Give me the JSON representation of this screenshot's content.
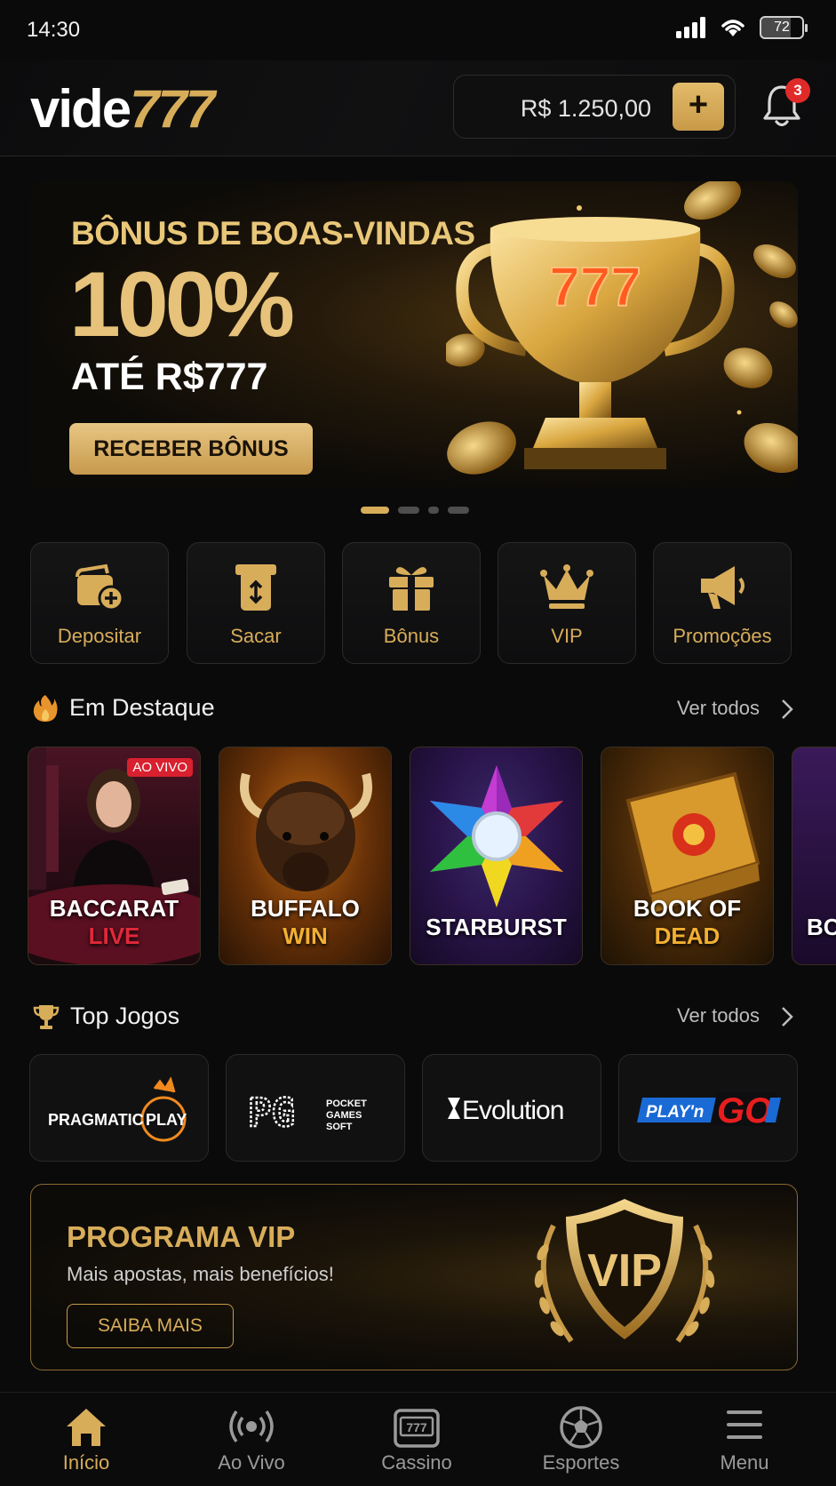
{
  "status_bar": {
    "time": "14:30",
    "battery": "72"
  },
  "header": {
    "logo_white": "vide",
    "logo_gold": "777",
    "balance": "R$ 1.250,00",
    "add_label": "+",
    "notification_count": "3"
  },
  "banner": {
    "title": "BÔNUS DE BOAS-VINDAS",
    "percent": "100%",
    "limit": "ATÉ R$777",
    "cta": "RECEBER BÔNUS",
    "trophy_text": "777",
    "slides": 4,
    "active_slide": 1
  },
  "quick_actions": [
    {
      "label": "Depositar",
      "icon": "wallet-plus-icon"
    },
    {
      "label": "Sacar",
      "icon": "withdraw-icon"
    },
    {
      "label": "Bônus",
      "icon": "gift-icon"
    },
    {
      "label": "VIP",
      "icon": "crown-icon"
    },
    {
      "label": "Promoções",
      "icon": "megaphone-icon"
    }
  ],
  "featured": {
    "title": "Em Destaque",
    "link": "Ver todos",
    "games": [
      {
        "line1": "BACCARAT",
        "line2": "LIVE",
        "badge": "AO VIVO"
      },
      {
        "line1": "BUFFALO",
        "line2": "WIN"
      },
      {
        "line1": "STARBURST",
        "line2": ""
      },
      {
        "line1": "BOOK OF",
        "line2": "DEAD"
      },
      {
        "line1": "BC",
        "line2": ""
      }
    ]
  },
  "top_games": {
    "title": "Top Jogos",
    "link": "Ver todos",
    "providers": [
      {
        "name": "PRAGMATIC",
        "name2": "PLAY"
      },
      {
        "name": "PG",
        "name2": "POCKET GAMES SOFT"
      },
      {
        "name": "Evolution"
      },
      {
        "name": "PLAY'n",
        "name2": "GO"
      }
    ]
  },
  "vip": {
    "title": "PROGRAMA VIP",
    "subtitle": "Mais apostas, mais benefícios!",
    "cta": "SAIBA MAIS",
    "shield_text": "VIP"
  },
  "bottom_nav": [
    {
      "label": "Início",
      "icon": "home-icon",
      "active": true
    },
    {
      "label": "Ao Vivo",
      "icon": "live-broadcast-icon"
    },
    {
      "label": "Cassino",
      "icon": "slot-machine-icon"
    },
    {
      "label": "Esportes",
      "icon": "soccer-ball-icon"
    },
    {
      "label": "Menu",
      "icon": "hamburger-menu-icon"
    }
  ],
  "colors": {
    "gold": "#d8ad5a",
    "background": "#0a0a0b",
    "live_red": "#e0283a",
    "badge_red": "#e02a2a"
  }
}
